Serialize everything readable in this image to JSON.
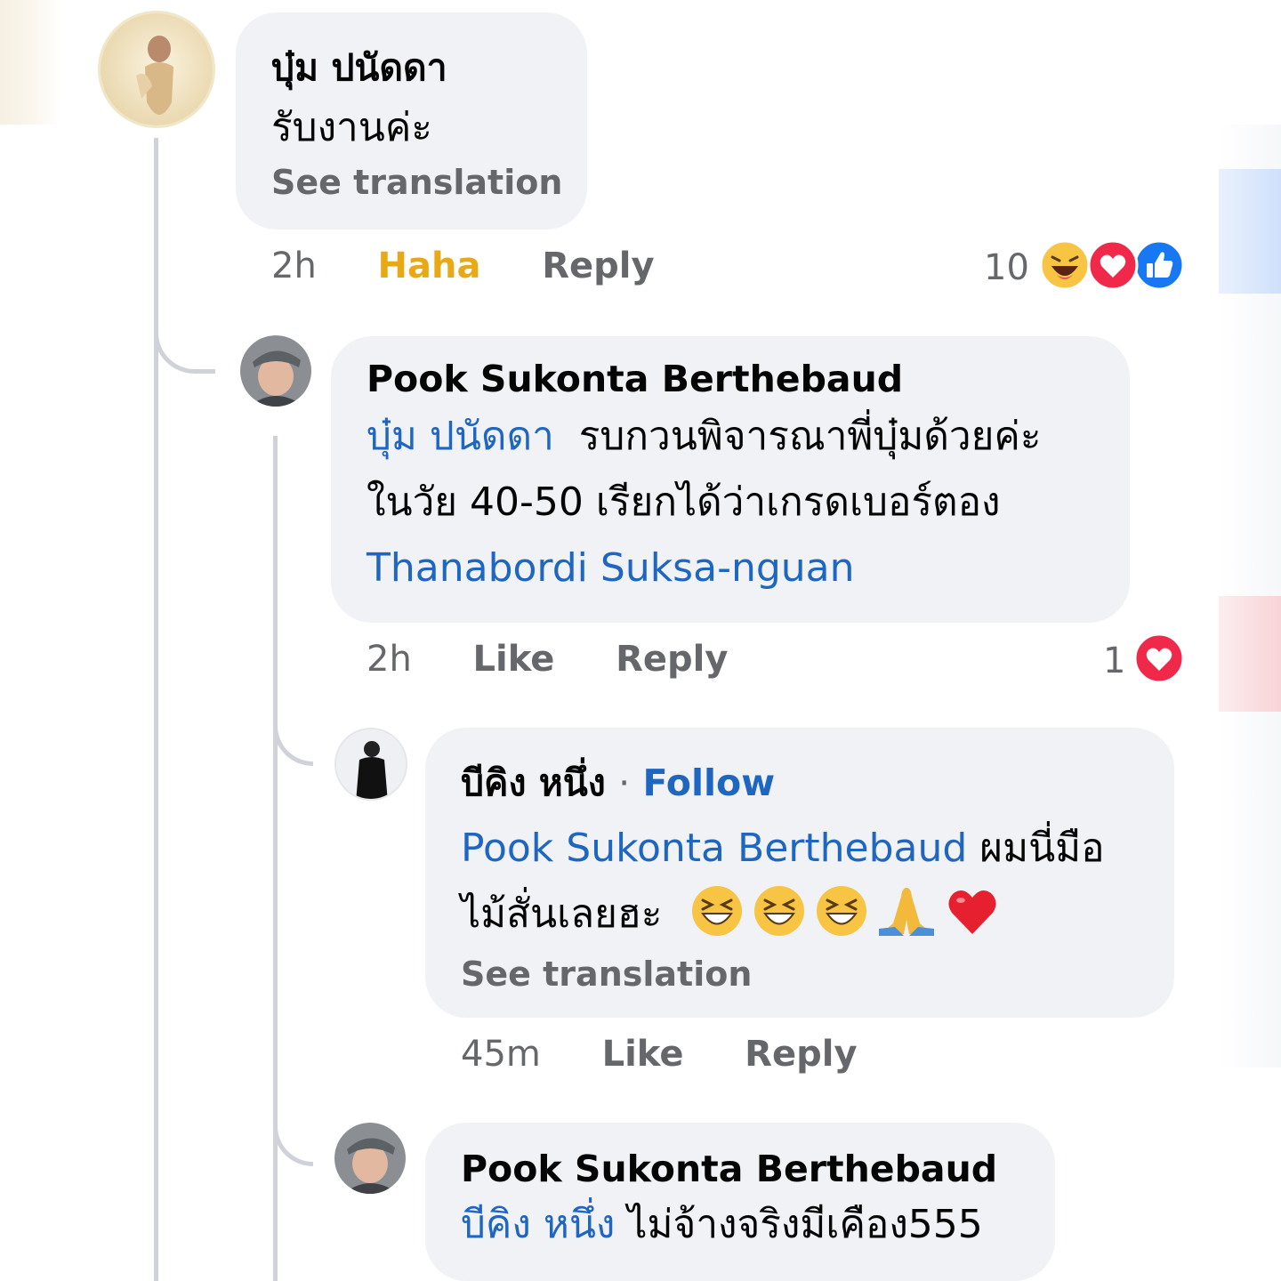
{
  "comments": [
    {
      "author": "บุ๋ม ปนัดดา",
      "text": "รับงานค่ะ",
      "see_translation": "See translation",
      "time": "2h",
      "reaction_action": "Haha",
      "reply": "Reply",
      "reaction_count": "10",
      "reaction_icons": [
        "haha-icon",
        "love-icon",
        "like-icon"
      ]
    },
    {
      "author": "Pook Sukonta Berthebaud",
      "mention": "บุ๋ม ปนัดดา",
      "text_line1": "รบกวนพิจารณาพี่บุ๋มด้วยค่ะ",
      "text_line2": "ในวัย 40-50 เรียกได้ว่าเกรดเบอร์ตอง",
      "tag": "Thanabordi Suksa-nguan",
      "time": "2h",
      "like": "Like",
      "reply": "Reply",
      "reaction_count": "1",
      "reaction_icons": [
        "love-icon"
      ]
    },
    {
      "author": "บีคิง หนึ่ง",
      "separator": "·",
      "follow": "Follow",
      "mention": "Pook Sukonta Berthebaud",
      "text_line1": "ผมนี่มือ",
      "text_line2": "ไม้สั่นเลยฮะ",
      "emojis": [
        "laughing-emoji",
        "laughing-emoji",
        "laughing-emoji",
        "folded-hands-emoji",
        "red-heart-emoji"
      ],
      "see_translation": "See translation",
      "time": "45m",
      "like": "Like",
      "reply": "Reply"
    },
    {
      "author": "Pook Sukonta Berthebaud",
      "mention": "บีคิง หนึ่ง",
      "text": "ไม่จ้างจริงมีเคือง555"
    }
  ],
  "colors": {
    "bubble": "#f0f2f5",
    "mention": "#1f66c1",
    "meta_text": "#65676b",
    "haha": "#e9a916",
    "love": "#f0284a",
    "like": "#1877f2",
    "thread_line": "#cfd2d8"
  }
}
